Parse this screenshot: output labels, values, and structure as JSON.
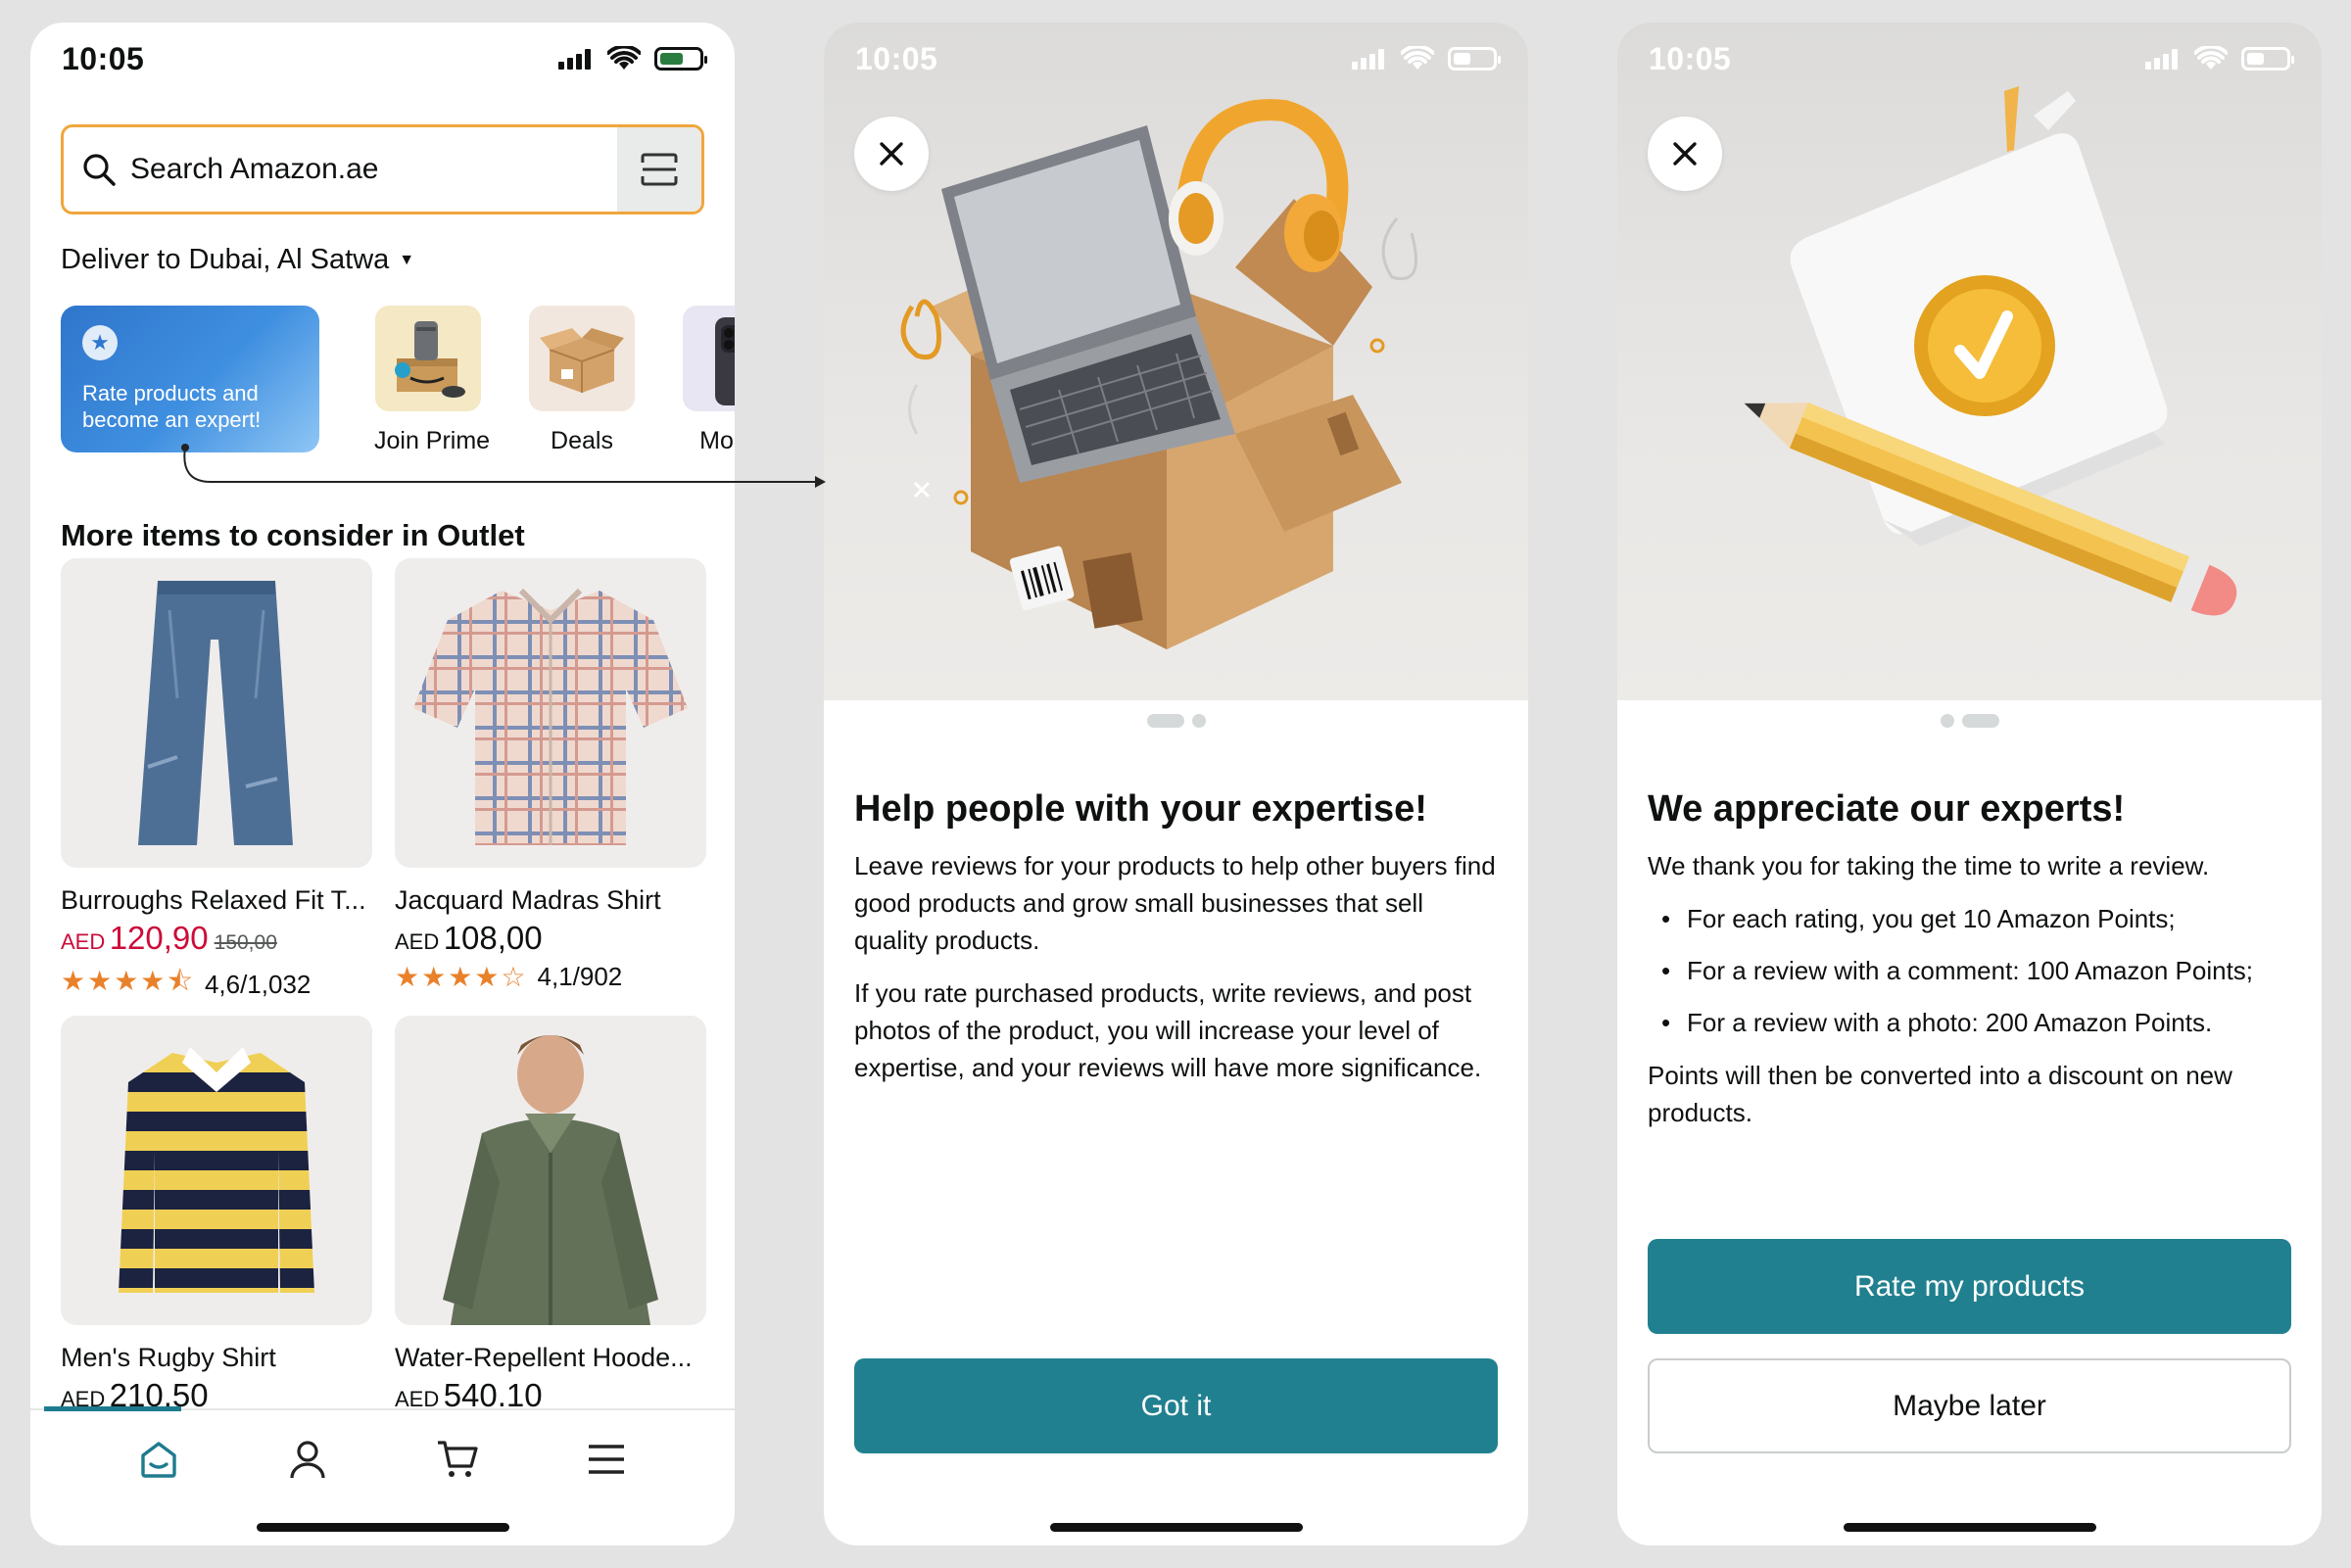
{
  "status_bar": {
    "time": "10:05"
  },
  "colors": {
    "accent": "#21808f",
    "search_border": "#f0a63c",
    "sale_red": "#cc0c39",
    "star_orange": "#e9812b",
    "battery_green": "#2a7d3f"
  },
  "home": {
    "search": {
      "placeholder": "Search Amazon.ae",
      "icon": "search-icon",
      "scan_icon": "scan-icon"
    },
    "deliver": "Deliver to Dubai, Al Satwa",
    "promo_card": "Rate products and become an expert!",
    "categories": [
      {
        "label": "Join Prime"
      },
      {
        "label": "Deals"
      },
      {
        "label": "Mobile"
      }
    ],
    "section_title": "More items to consider in Outlet",
    "products": [
      {
        "name": "Burroughs Relaxed Fit T...",
        "currency": "AED",
        "price": "120,90",
        "old_price": "150,00",
        "rating_text": "4,6/1,032",
        "stars": "★★★★⯪"
      },
      {
        "name": "Jacquard Madras Shirt",
        "currency": "AED",
        "price": "108,00",
        "rating_text": "4,1/902",
        "stars": "★★★★☆"
      },
      {
        "name": "Men's Rugby Shirt",
        "currency": "AED",
        "price": "210.50"
      },
      {
        "name": "Water-Repellent Hoode...",
        "currency": "AED",
        "price": "540.10"
      }
    ],
    "tabbar": [
      "home-icon",
      "account-icon",
      "cart-icon",
      "menu-icon"
    ]
  },
  "modal1": {
    "title": "Help people with your expertise!",
    "p1": "Leave reviews for your products to help other buyers find good products and grow small businesses that sell quality products.",
    "p2": "If you rate purchased products, write reviews, and post photos of the product, you will increase your level of expertise, and your reviews will have more significance.",
    "button": "Got it"
  },
  "modal2": {
    "title": "We appreciate our experts!",
    "intro": "We thank you for taking the time to write a review.",
    "bullets": [
      "For each rating, you get 10 Amazon Points;",
      "For a review with a comment: 100 Amazon Points;",
      "For a review with a photo: 200 Amazon Points."
    ],
    "outro": "Points will then be converted into a discount on new products.",
    "primary_button": "Rate my products",
    "secondary_button": "Maybe later"
  }
}
